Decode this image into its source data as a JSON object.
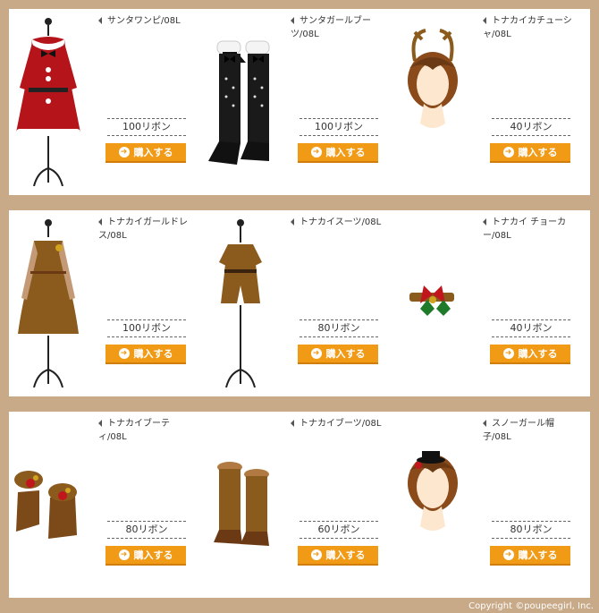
{
  "items": [
    {
      "name": "サンタワンピ/08L",
      "price": "100リボン",
      "button": "購入する",
      "thumb": "dress-santa-icon"
    },
    {
      "name": "サンタガールブーツ/08L",
      "price": "100リボン",
      "button": "購入する",
      "thumb": "boots-santa-icon"
    },
    {
      "name": "トナカイカチューシャ/08L",
      "price": "40リボン",
      "button": "購入する",
      "thumb": "headband-antler-icon"
    },
    {
      "name": "トナカイガールドレス/08L",
      "price": "100リボン",
      "button": "購入する",
      "thumb": "dress-reindeer-icon"
    },
    {
      "name": "トナカイスーツ/08L",
      "price": "80リボン",
      "button": "購入する",
      "thumb": "suit-reindeer-icon"
    },
    {
      "name": "トナカイ チョーカー/08L",
      "price": "40リボン",
      "button": "購入する",
      "thumb": "choker-icon"
    },
    {
      "name": "トナカイブーティ/08L",
      "price": "80リボン",
      "button": "購入する",
      "thumb": "bootie-icon"
    },
    {
      "name": "トナカイブーツ/08L",
      "price": "60リボン",
      "button": "購入する",
      "thumb": "boots-reindeer-icon"
    },
    {
      "name": "スノーガール帽子/08L",
      "price": "80リボン",
      "button": "購入する",
      "thumb": "hat-snowgirl-icon"
    }
  ],
  "footer": {
    "copyright": "Copyright ©poupeegirl, Inc."
  }
}
